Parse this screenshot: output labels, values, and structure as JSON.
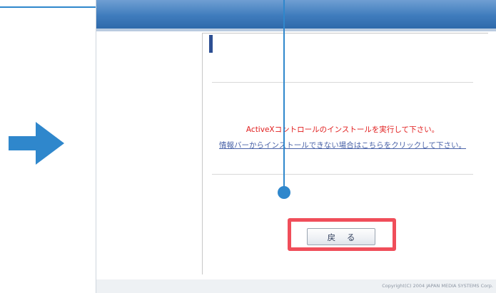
{
  "page": {
    "message": "ActiveXコントロールのインストールを実行して下さい。",
    "help_link": "情報バーからインストールできない場合はこちらをクリックして下さい。",
    "back_button": "戻 る",
    "copyright": "Copyright(C) 2004 JAPAN MEDIA SYSTEMS Corp."
  },
  "colors": {
    "accent_blue": "#2f87cc",
    "highlight_red": "#f04e5a",
    "message_red": "#e11d1d",
    "link_blue": "#4a63a8",
    "header_blue": "#3f7cbd"
  },
  "icons": {
    "arrow": "arrow-right-icon",
    "pointer": "pointer-dot-icon"
  }
}
